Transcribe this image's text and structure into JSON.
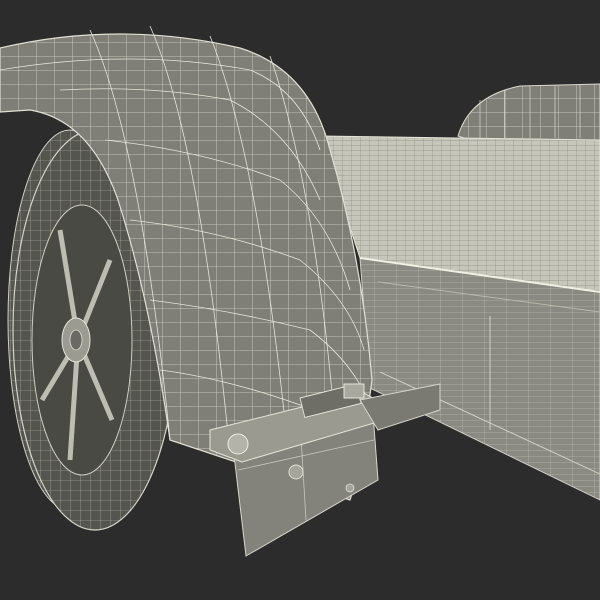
{
  "scene": {
    "subject": "wireframe-3d-render",
    "colors": {
      "background": "#2c2c2c",
      "surface": "#7e7e76",
      "surface_dark": "#5f5f58",
      "surface_light": "#96968e",
      "deck": "#c9c9bd",
      "wire": "#e8e8dc",
      "tire_dark": "#3c3c38"
    }
  }
}
